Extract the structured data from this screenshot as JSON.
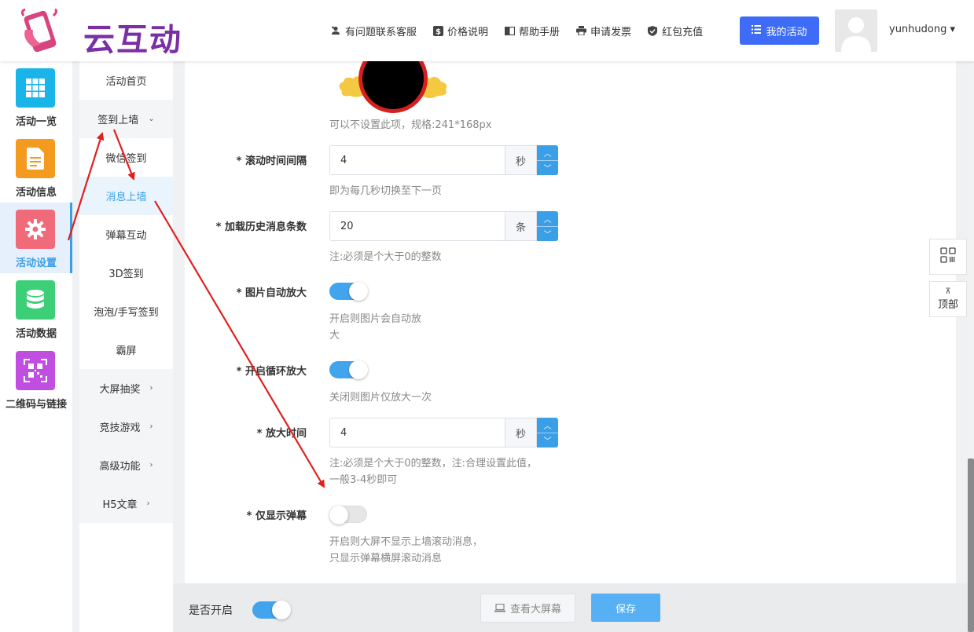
{
  "header": {
    "logo_text": "云互动",
    "nav": [
      {
        "label": "有问题联系客服",
        "icon": "add-user-icon"
      },
      {
        "label": "价格说明",
        "icon": "dollar-icon"
      },
      {
        "label": "帮助手册",
        "icon": "book-icon"
      },
      {
        "label": "申请发票",
        "icon": "printer-icon"
      },
      {
        "label": "红包充值",
        "icon": "shield-check-icon"
      }
    ],
    "my_activity_label": "我的活动",
    "username": "yunhudong ▾"
  },
  "sidebar": {
    "items": [
      {
        "label": "活动一览",
        "icon": "grid-icon",
        "color": "#1ab5e8"
      },
      {
        "label": "活动信息",
        "icon": "document-icon",
        "color": "#f39a1f"
      },
      {
        "label": "活动设置",
        "icon": "gear-icon",
        "color": "#f06a7a"
      },
      {
        "label": "活动数据",
        "icon": "database-icon",
        "color": "#3ccf78"
      },
      {
        "label": "二维码与链接",
        "icon": "qrcode-icon",
        "color": "#c04ee0"
      }
    ]
  },
  "submenu": {
    "items": [
      "活动首页",
      "签到上墙",
      "微信签到",
      "消息上墙",
      "弹幕互动",
      "3D签到",
      "泡泡/手写签到",
      "霸屏",
      "大屏抽奖",
      "竞技游戏",
      "高级功能",
      "H5文章"
    ]
  },
  "form": {
    "image_hint": "可以不设置此项，规格:241*168px",
    "scroll_interval": {
      "label": "* 滚动时间间隔",
      "value": "4",
      "unit": "秒",
      "hint": "即为每几秒切换至下一页"
    },
    "history_count": {
      "label": "* 加载历史消息条数",
      "value": "20",
      "unit": "条",
      "hint": "注:必须是个大于0的整数"
    },
    "auto_zoom": {
      "label": "* 图片自动放大",
      "hint_line1": "开启则图片会自动放",
      "hint_line2": "大"
    },
    "loop_zoom": {
      "label": "* 开启循环放大",
      "hint": "关闭则图片仅放大一次"
    },
    "zoom_time": {
      "label": "* 放大时间",
      "value": "4",
      "unit": "秒",
      "hint_line1": "注:必须是个大于0的整数，注:合理设置此值，",
      "hint_line2": "一般3-4秒即可"
    },
    "danmu_only": {
      "label": "* 仅显示弹幕",
      "hint_line1": "开启则大屏不显示上墙滚动消息，",
      "hint_line2": "只显示弹幕横屏滚动消息"
    }
  },
  "bottom": {
    "enable_label": "是否开启",
    "preview_label": "查看大屏幕",
    "save_label": "保存"
  },
  "float": {
    "top_label": "顶部"
  },
  "colors": {
    "accent": "#3b9fe8",
    "primary_button": "#3e6cf6",
    "annotation_arrow": "#e02020"
  }
}
